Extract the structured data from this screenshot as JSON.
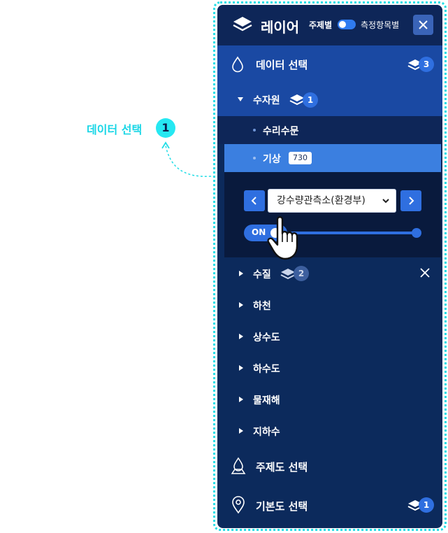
{
  "callout": {
    "label": "데이터 선택",
    "number": "1"
  },
  "header": {
    "title": "레이어",
    "mode_a": "주제별",
    "mode_b": "측정항목별"
  },
  "sections": {
    "data_select": {
      "label": "데이터 선택",
      "count": "3"
    },
    "theme_select": {
      "label": "주제도 선택"
    },
    "base_select": {
      "label": "기본도 선택",
      "count": "1"
    }
  },
  "water": {
    "label": "수자원",
    "count": "1"
  },
  "sub_items": [
    {
      "label": "수리수문"
    },
    {
      "label": "기상",
      "tag": "730"
    }
  ],
  "detail": {
    "select_value": "강수량관측소(환경부)",
    "toggle_label": "ON"
  },
  "categories": [
    {
      "label": "수질",
      "count": "2"
    },
    {
      "label": "하천"
    },
    {
      "label": "상수도"
    },
    {
      "label": "하수도"
    },
    {
      "label": "물재해"
    },
    {
      "label": "지하수"
    }
  ],
  "colors": {
    "accent": "#2f6fe0",
    "panel": "#0c2a5c",
    "highlight": "#3b7fe0",
    "callout": "#22dde6"
  }
}
